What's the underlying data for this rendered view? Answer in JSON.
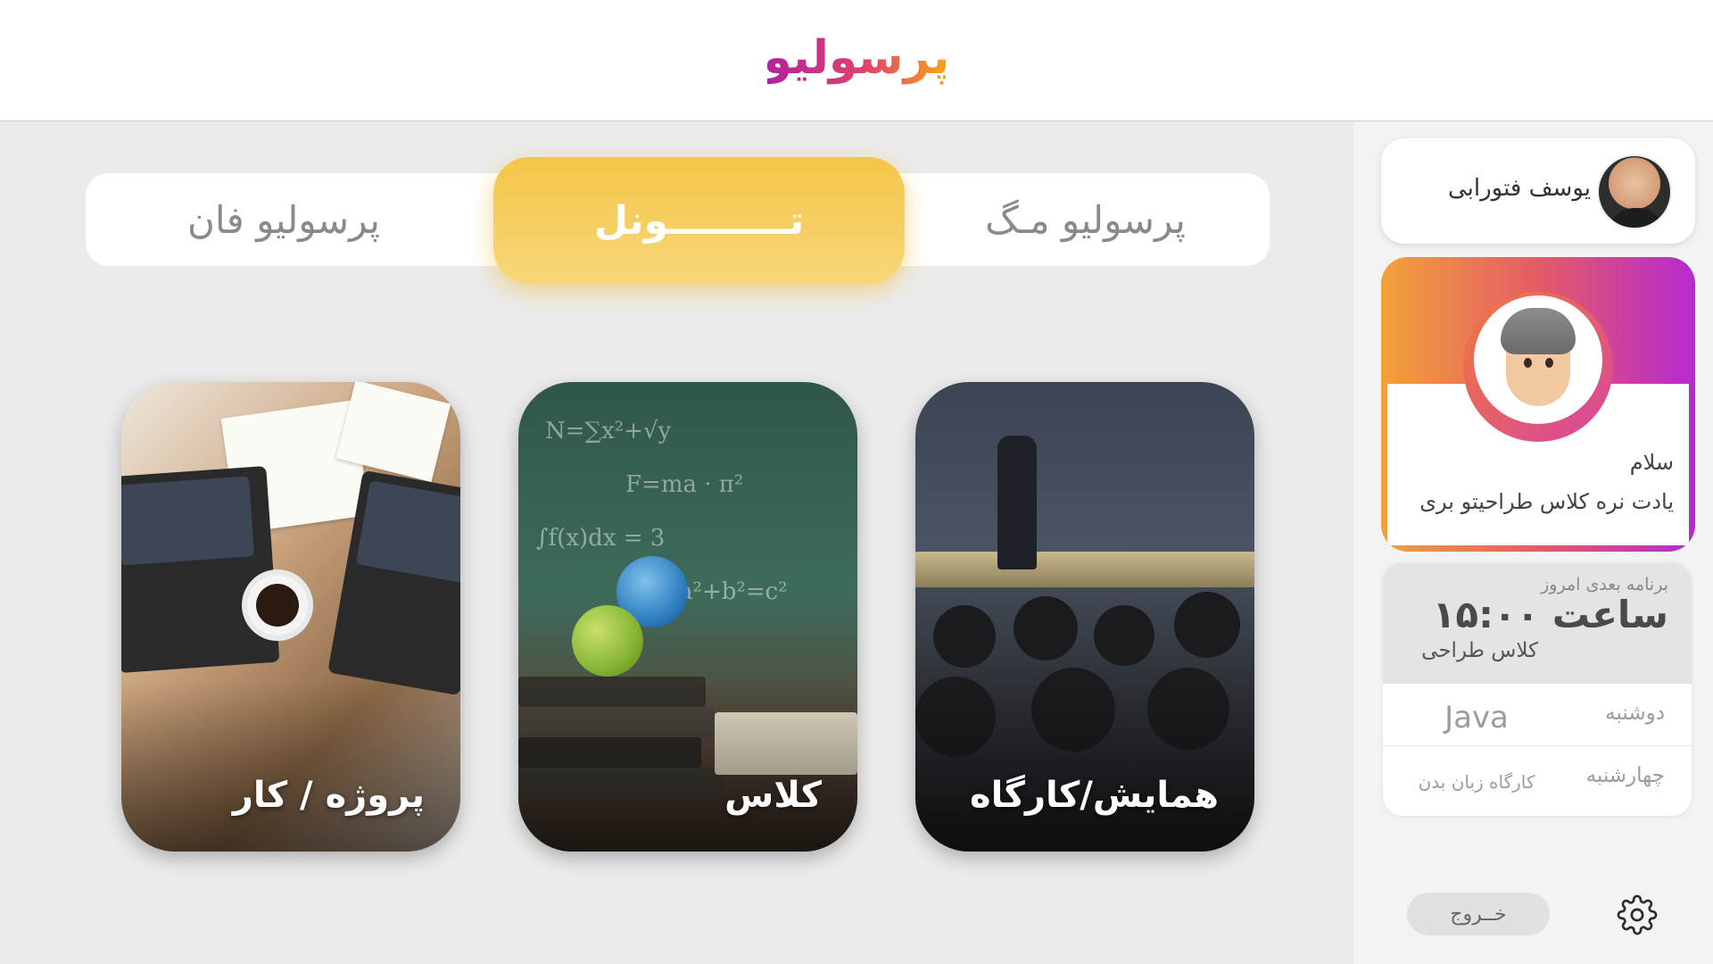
{
  "app": {
    "logo_text": "پرسولیو"
  },
  "tabs": [
    {
      "id": "fun",
      "label": "پرسولیو فان",
      "active": false
    },
    {
      "id": "tunnel",
      "label": "تـــــــــونل",
      "active": true
    },
    {
      "id": "mag",
      "label": "پرسولیو مـگ",
      "active": false
    }
  ],
  "cards": {
    "project": {
      "label": "پروژه / کار"
    },
    "class": {
      "label": "کلاس"
    },
    "seminar": {
      "label": "همایش/کارگاه"
    }
  },
  "profile": {
    "name": "یوسف فتورابی"
  },
  "greeting": {
    "hello": "سلام",
    "message": "یادت نره کلاس طراحیتو بری"
  },
  "schedule": {
    "next_title": "برنامه بعدی امروز",
    "next_time": "ساعت ۱۵:۰۰",
    "next_class": "کلاس طراحی",
    "rows": [
      {
        "day": "دوشنبه",
        "subject": "Java"
      },
      {
        "day": "چهارشنبه",
        "subject": "کارگاه زبان بدن"
      }
    ]
  },
  "actions": {
    "logout": "خــروج"
  },
  "icons": {
    "settings": "gear-icon"
  },
  "colors": {
    "tab_active": "#f4c649",
    "gradient_start": "#f2a23a",
    "gradient_end": "#b52ad0",
    "background": "#ebebeb"
  }
}
